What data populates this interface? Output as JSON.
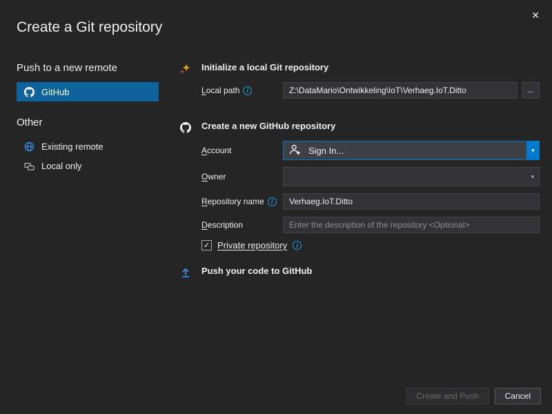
{
  "window": {
    "title": "Create a Git repository"
  },
  "sidebar": {
    "push_heading": "Push to a new remote",
    "other_heading": "Other",
    "items": {
      "github": "GitHub",
      "existing_remote": "Existing remote",
      "local_only": "Local only"
    }
  },
  "sections": {
    "init": {
      "title": "Initialize a local Git repository",
      "local_path_label": "Local path",
      "local_path_value": "Z:\\DataMario\\Ontwikkeling\\IoT\\Verhaeg.IoT.Ditto",
      "browse_label": "..."
    },
    "github": {
      "title": "Create a new GitHub repository",
      "account_label": "Account",
      "signin_label": "Sign In...",
      "owner_label": "Owner",
      "owner_value": "",
      "repo_name_label": "Repository name",
      "repo_name_value": "Verhaeg.IoT.Ditto",
      "description_label": "Description",
      "description_placeholder": "Enter the description of the repository <Optional>",
      "private_label": "Private repository",
      "private_checked": true
    },
    "push": {
      "title": "Push your code to GitHub"
    }
  },
  "footer": {
    "create_push": "Create and Push",
    "cancel": "Cancel"
  }
}
